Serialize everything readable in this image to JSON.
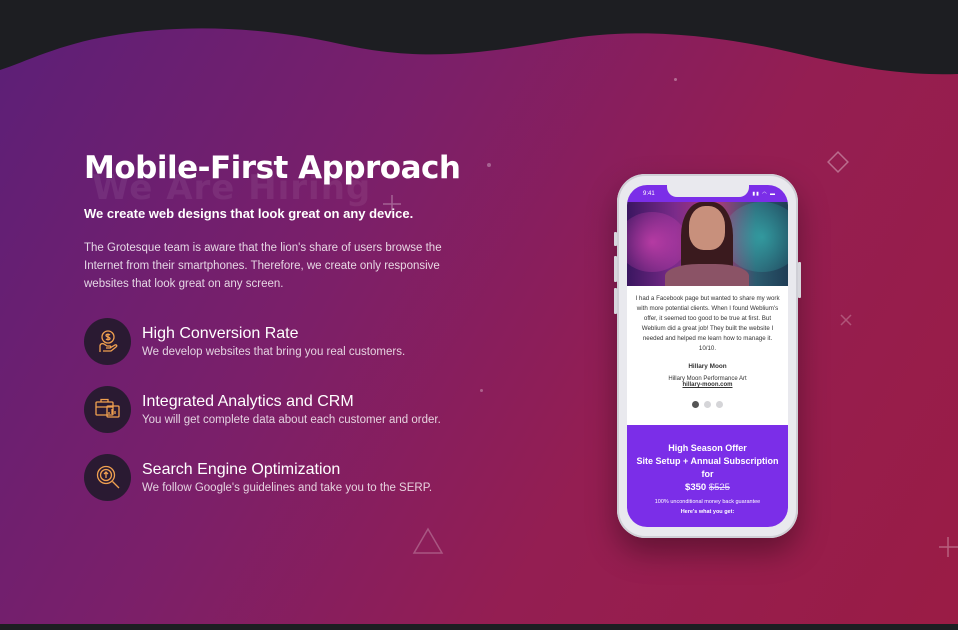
{
  "section": {
    "watermark": "We Are Hiring",
    "title": "Mobile-First Approach",
    "subtitle": "We create web designs that look great on any device.",
    "body": "The Grotesque team is aware that the lion's share of users browse the Internet from their smartphones. Therefore, we create only responsive websites that look great on any screen."
  },
  "features": [
    {
      "icon": "conversion-hand-dollar-icon",
      "title": "High Conversion Rate",
      "desc": "We develop websites that bring you real customers."
    },
    {
      "icon": "analytics-briefcase-icon",
      "title": "Integrated Analytics and CRM",
      "desc": "You will get complete data about each customer and order."
    },
    {
      "icon": "seo-magnifier-icon",
      "title": "Search Engine Optimization",
      "desc": "We follow Google's guidelines and take you to the SERP."
    }
  ],
  "phone": {
    "time": "9:41",
    "testimonial": {
      "quote": "I had a Facebook page but wanted to share my work with more potential clients. When I found Weblium's offer, it seemed too good to be true at first. But Weblium did a great job! They built the website I needed and helped me learn how to manage it. 10/10.",
      "name": "Hillary Moon",
      "company": "Hillary Moon Performance Art",
      "link": "hillary-moon.com"
    },
    "offer": {
      "line1": "High Season Offer",
      "line2": "Site Setup + Annual Subscription",
      "line3": "for",
      "price": "$350",
      "old_price": "$525",
      "guarantee": "100% unconditional money back guarantee",
      "whats": "Here's what you get:"
    }
  },
  "colors": {
    "accent": "#7b2ee8",
    "icon_stroke": "#f0a050",
    "bg_start": "#5b1f78",
    "bg_end": "#9a1c45"
  }
}
